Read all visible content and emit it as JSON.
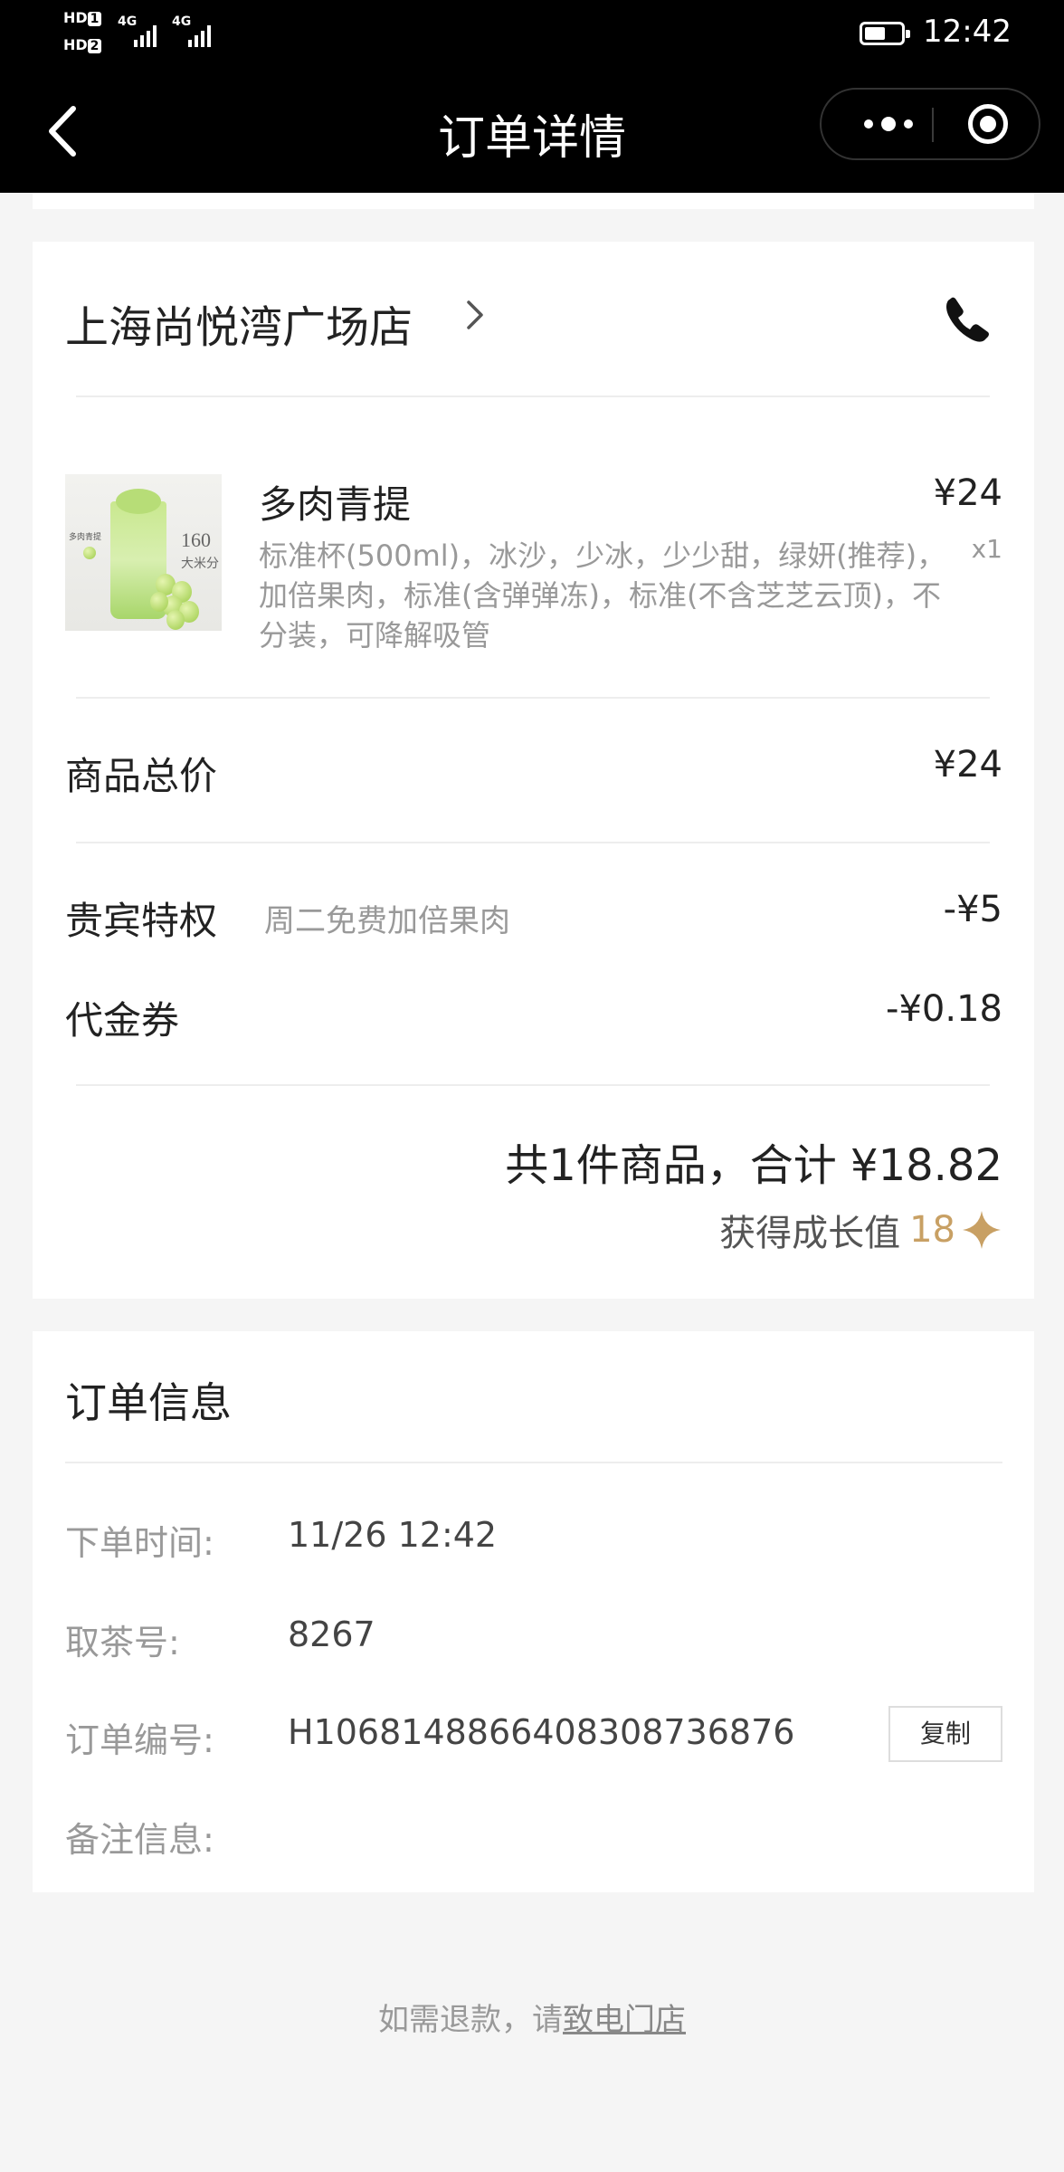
{
  "status_bar": {
    "sim1_label": "HD",
    "sim1_index": "1",
    "sim2_label": "HD",
    "sim2_index": "2",
    "network1": "4G",
    "network2": "4G",
    "time": "12:42",
    "battery_level": 0.5
  },
  "nav": {
    "title": "订单详情",
    "back_icon": "chevron-left-icon",
    "more_icon": "more-dots-icon",
    "close_icon": "target-circle-icon"
  },
  "store": {
    "name": "上海尚悦湾广场店",
    "chevron_icon": "chevron-right-icon",
    "phone_icon": "phone-icon"
  },
  "item": {
    "name": "多肉青提",
    "price": "¥24",
    "quantity": "x1",
    "description": "标准杯(500ml)，冰沙，少冰，少少甜，绿妍(推荐)，加倍果肉，标准(含弹弹冻)，标准(不含芝芝云顶)，不分装，可降解吸管",
    "image_text": {
      "brand": "多肉青提",
      "big_number": "160",
      "caption": "大米分"
    }
  },
  "summary": {
    "subtotal_label": "商品总价",
    "subtotal_value": "¥24",
    "vip_label": "贵宾特权",
    "vip_desc": "周二免费加倍果肉",
    "vip_value": "-¥5",
    "coupon_label": "代金券",
    "coupon_value": "-¥0.18",
    "total_text": "共1件商品，合计 ¥18.82",
    "growth_label": "获得成长值",
    "growth_value": "18",
    "growth_icon": "sparkle-star-icon"
  },
  "order_info": {
    "title": "订单信息",
    "time_label": "下单时间:",
    "time_value": "11/26 12:42",
    "pickup_label": "取茶号:",
    "pickup_value": "8267",
    "order_no_label": "订单编号:",
    "order_no_value": "H1068148866408308736876",
    "copy_label": "复制",
    "note_label": "备注信息:",
    "note_value": ""
  },
  "footer": {
    "refund_prefix": "如需退款，请",
    "refund_link": "致电门店"
  },
  "colors": {
    "accent_gold": "#c8a064",
    "nav_bg": "#000000",
    "page_bg": "#f5f5f5"
  }
}
